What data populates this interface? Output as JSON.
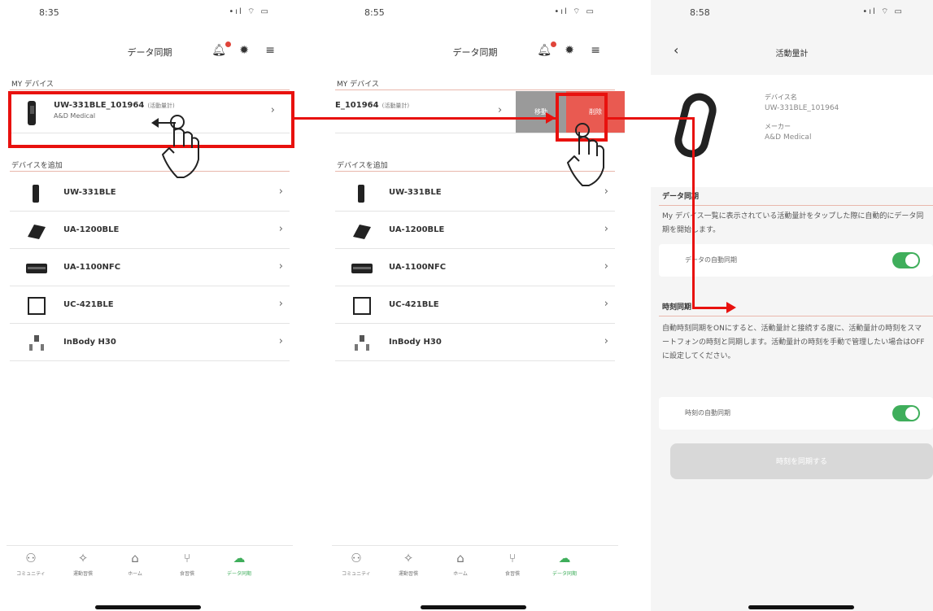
{
  "phone1": {
    "status": {
      "time": "8:35",
      "icons": "•ıl ⌔ ▭"
    },
    "header": {
      "title": "データ同期"
    },
    "my_devices_label": "MY デバイス",
    "my_device": {
      "name": "UW-331BLE_101964",
      "tag": "(活動量計)",
      "maker": "A&D Medical"
    },
    "add_device_label": "デバイスを追加",
    "devices": [
      "UW-331BLE",
      "UA-1200BLE",
      "UA-1100NFC",
      "UC-421BLE",
      "InBody H30"
    ]
  },
  "phone2": {
    "status": {
      "time": "8:55",
      "icons": "•ıl ⌔ ▭"
    },
    "header": {
      "title": "データ同期"
    },
    "my_devices_label": "MY デバイス",
    "my_device": {
      "name": "E_101964",
      "tag": "(活動量計)"
    },
    "actions": {
      "gray": "移動",
      "red": "削除"
    },
    "add_device_label": "デバイスを追加",
    "devices": [
      "UW-331BLE",
      "UA-1200BLE",
      "UA-1100NFC",
      "UC-421BLE",
      "InBody H30"
    ]
  },
  "phone3": {
    "status": {
      "time": "8:58",
      "icons": "•ıl ⌔ ▭"
    },
    "title": "活動量計",
    "device_label": "デバイス名",
    "device_name": "UW-331BLE_101964",
    "maker_label": "メーカー",
    "maker_name": "A&D Medical",
    "data_sync": {
      "heading": "データ同期",
      "description": "My デバイス一覧に表示されている活動量計をタップした際に自動的にデータ同期を開始します。",
      "toggle_label": "データの自動同期"
    },
    "time_sync": {
      "heading": "時刻同期",
      "description": "自動時刻同期をONにすると、活動量計と接続する度に、活動量計の時刻をスマートフォンの時刻と同期します。活動量計の時刻を手動で管理したい場合はOFFに設定してください。",
      "toggle_label": "時刻の自動同期",
      "button": "時刻を同期する"
    }
  },
  "tabs": [
    {
      "icon": "community-icon",
      "label": "コミュニティ"
    },
    {
      "icon": "activity-icon",
      "label": "運動習慣"
    },
    {
      "icon": "home-icon",
      "label": "ホーム"
    },
    {
      "icon": "meal-icon",
      "label": "食習慣"
    },
    {
      "icon": "cloud-upload-icon",
      "label": "データ同期"
    }
  ],
  "colors": {
    "accent_red": "#e8110e",
    "toggle_green": "#3fae5b",
    "delete_red": "#e95a51"
  }
}
